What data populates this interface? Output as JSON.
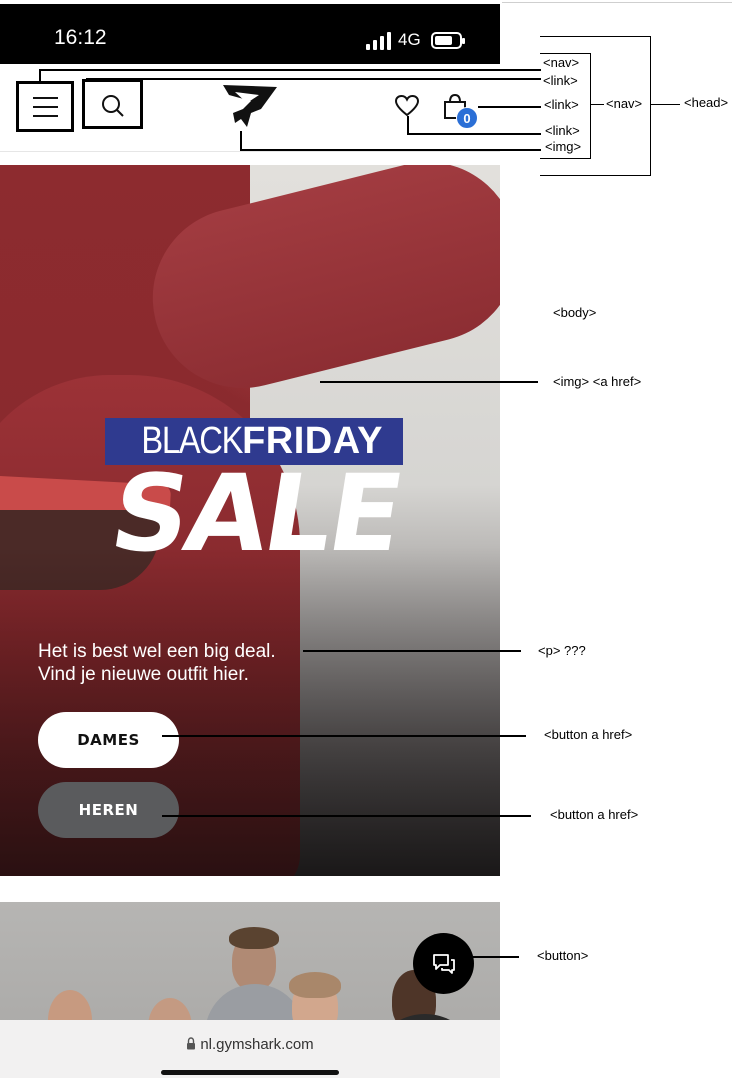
{
  "status_bar": {
    "time": "16:12",
    "network": "4G"
  },
  "header": {
    "menu_icon": "hamburger-menu-icon",
    "search_icon": "search-icon",
    "logo_icon": "gymshark-logo-icon",
    "wishlist_icon": "heart-icon",
    "bag_icon": "shopping-bag-icon",
    "bag_count": "0"
  },
  "hero": {
    "badge_black": "BLACK",
    "badge_friday": "FRIDAY",
    "headline": "SALE",
    "tagline_line1": "Het is best wel een big deal.",
    "tagline_line2": "Vind je nieuwe outfit hier.",
    "button_women": "DAMES",
    "button_men": "HEREN"
  },
  "chat_button_icon": "chat-icon",
  "browser": {
    "url": "nl.gymshark.com",
    "lock_icon": "lock-icon"
  },
  "annotations": {
    "nav_inner": "<nav>",
    "link_menu": "<link>",
    "link_search": "<link>",
    "link_bag": "<link>",
    "link_wishlist": "<link>",
    "img_logo": "<img>",
    "nav_outer": "<nav>",
    "head": "<head>",
    "body": "<body>",
    "hero_img": "<img> <a href>",
    "paragraph": "<p> ???",
    "button_dames": "<button a href>",
    "button_heren": "<button a href>",
    "chat_button": "<button>"
  },
  "colors": {
    "badge_blue": "#2f3a8f",
    "bag_badge_blue": "#2b6fd6",
    "heren_button_gray": "#5a5b5d",
    "hero_red": "#8d2b2f"
  }
}
